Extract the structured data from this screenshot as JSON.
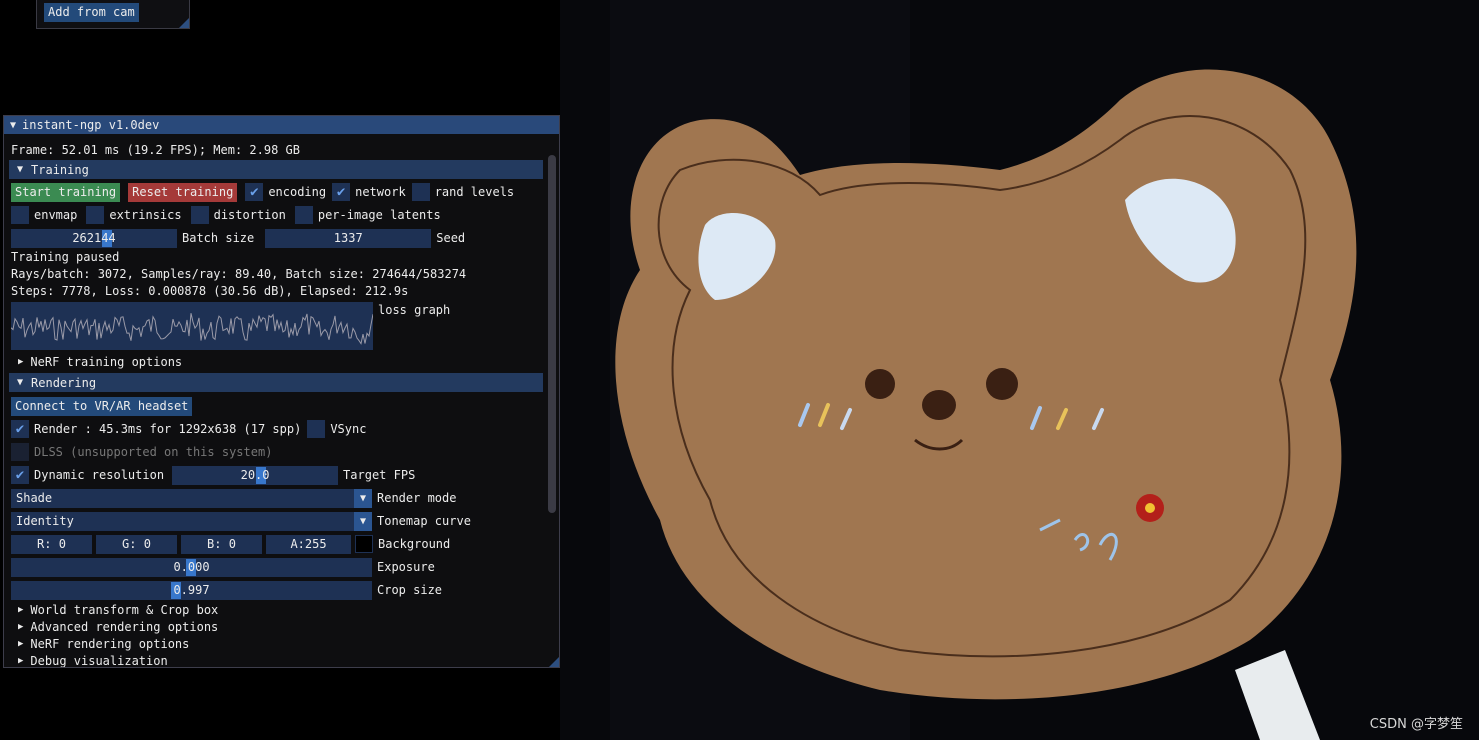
{
  "camera_window": {
    "add_from_cam": "Add from cam"
  },
  "window": {
    "title": "instant-ngp v1.0dev",
    "frame_info": "Frame: 52.01 ms (19.2 FPS); Mem: 2.98 GB"
  },
  "training": {
    "header": "Training",
    "start_button": "Start training",
    "reset_button": "Reset training",
    "checkboxes": [
      {
        "label": "encoding",
        "checked": true
      },
      {
        "label": "network",
        "checked": true
      },
      {
        "label": "rand levels",
        "checked": false
      },
      {
        "label": "envmap",
        "checked": false
      },
      {
        "label": "extrinsics",
        "checked": false
      },
      {
        "label": "distortion",
        "checked": false
      },
      {
        "label": "per-image latents",
        "checked": false
      }
    ],
    "batch_size_value": "262144",
    "batch_size_label": "Batch size",
    "seed_value": "1337",
    "seed_label": "Seed",
    "status": "Training paused",
    "stats_line1": "Rays/batch: 3072, Samples/ray: 89.40, Batch size: 274644/583274",
    "stats_line2": "Steps: 7778, Loss: 0.000878 (30.56 dB), Elapsed: 212.9s",
    "loss_graph_label": "loss graph",
    "nerf_training_options": "NeRF training options"
  },
  "rendering": {
    "header": "Rendering",
    "vr_button": "Connect to VR/AR headset",
    "render_label": "Render : 45.3ms for 1292x638 (17 spp)",
    "render_checked": true,
    "vsync_label": "VSync",
    "vsync_checked": false,
    "dlss_label": "DLSS (unsupported on this system)",
    "dynamic_res_label": "Dynamic resolution",
    "dynamic_res_checked": true,
    "target_fps_value": "20.0",
    "target_fps_label": "Target FPS",
    "render_mode_value": "Shade",
    "render_mode_label": "Render mode",
    "tonemap_value": "Identity",
    "tonemap_label": "Tonemap curve",
    "bg_r": "R:  0",
    "bg_g": "G:  0",
    "bg_b": "B:  0",
    "bg_a": "A:255",
    "background_label": "Background",
    "exposure_value": "0.000",
    "exposure_label": "Exposure",
    "crop_value": "0.997",
    "crop_label": "Crop size",
    "tree_items": [
      "World transform & Crop box",
      "Advanced rendering options",
      "NeRF rendering options",
      "Debug visualization"
    ]
  },
  "watermark": "CSDN @字梦笙",
  "colors": {
    "title_bar": "#29497a",
    "header": "#233a5f",
    "frame_bg": "#1e3154",
    "accent": "#3d84e0",
    "start": "#3b8b52",
    "reset": "#a53a39"
  }
}
